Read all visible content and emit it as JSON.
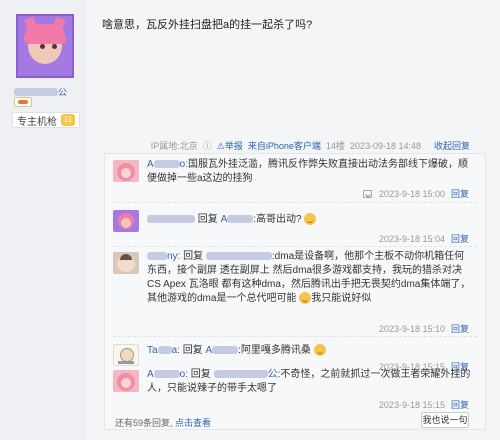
{
  "user": {
    "name_tail": "公",
    "title": "专主机枪",
    "level": "11"
  },
  "post": {
    "text": "啥意思，瓦反外挂扫盘把a的挂一起杀了吗?",
    "ip": "IP属地:北京",
    "report": "举报",
    "source": "来自iPhone客户端",
    "floor": "14楼",
    "time": "2023-09-18 14:48",
    "reply_toggle": "收起回复"
  },
  "comments": [
    {
      "name_suffix": "o:",
      "text": "国服瓦外挂泛滥，腾讯反作弊失败直接出动法务部线下爆破，顺便做掉一些a这边的挂狗",
      "time": "2023-9-18 15:00",
      "reply": "回复"
    },
    {
      "reply_word": "回复",
      "target": "A",
      "text": ":高哥出动?",
      "time": "2023-9-18 15:04",
      "reply": "回复"
    },
    {
      "name_suffix": "ny:",
      "reply_word": "回复",
      "text": ":dma是设备啊，他那个主板不动你机箱任何东西，接个副屏 透在副屏上 然后dma很多游戏都支持，我玩的猎杀对决 CS Apex 瓦洛眼 都有这种dma，然后腾讯出手把无畏契约dma集体端了，其他游戏的dma是一个总代吧可能",
      "text_tail": "我只能说好似",
      "time": "2023-9-18 15:10",
      "reply": "回复"
    },
    {
      "name": "Ta",
      "name_suffix": "a:",
      "reply_word": "回复",
      "target": "A",
      "text": ":阿里嘎多腾讯桑",
      "time": "2023-9-18 15:15",
      "reply": "回复"
    },
    {
      "name": "A",
      "name_suffix": "o:",
      "reply_word": "回复",
      "target_suffix": "公",
      "text": ":不奇怪，之前就抓过一次做王者荣耀外挂的人，只能说辣子的带手太嗯了",
      "time": "2023-9-18 15:15",
      "reply": "回复"
    }
  ],
  "footer": {
    "count_text": "还有59条回复,",
    "more_link": "点击查看",
    "reply_button": "我也说一句"
  }
}
